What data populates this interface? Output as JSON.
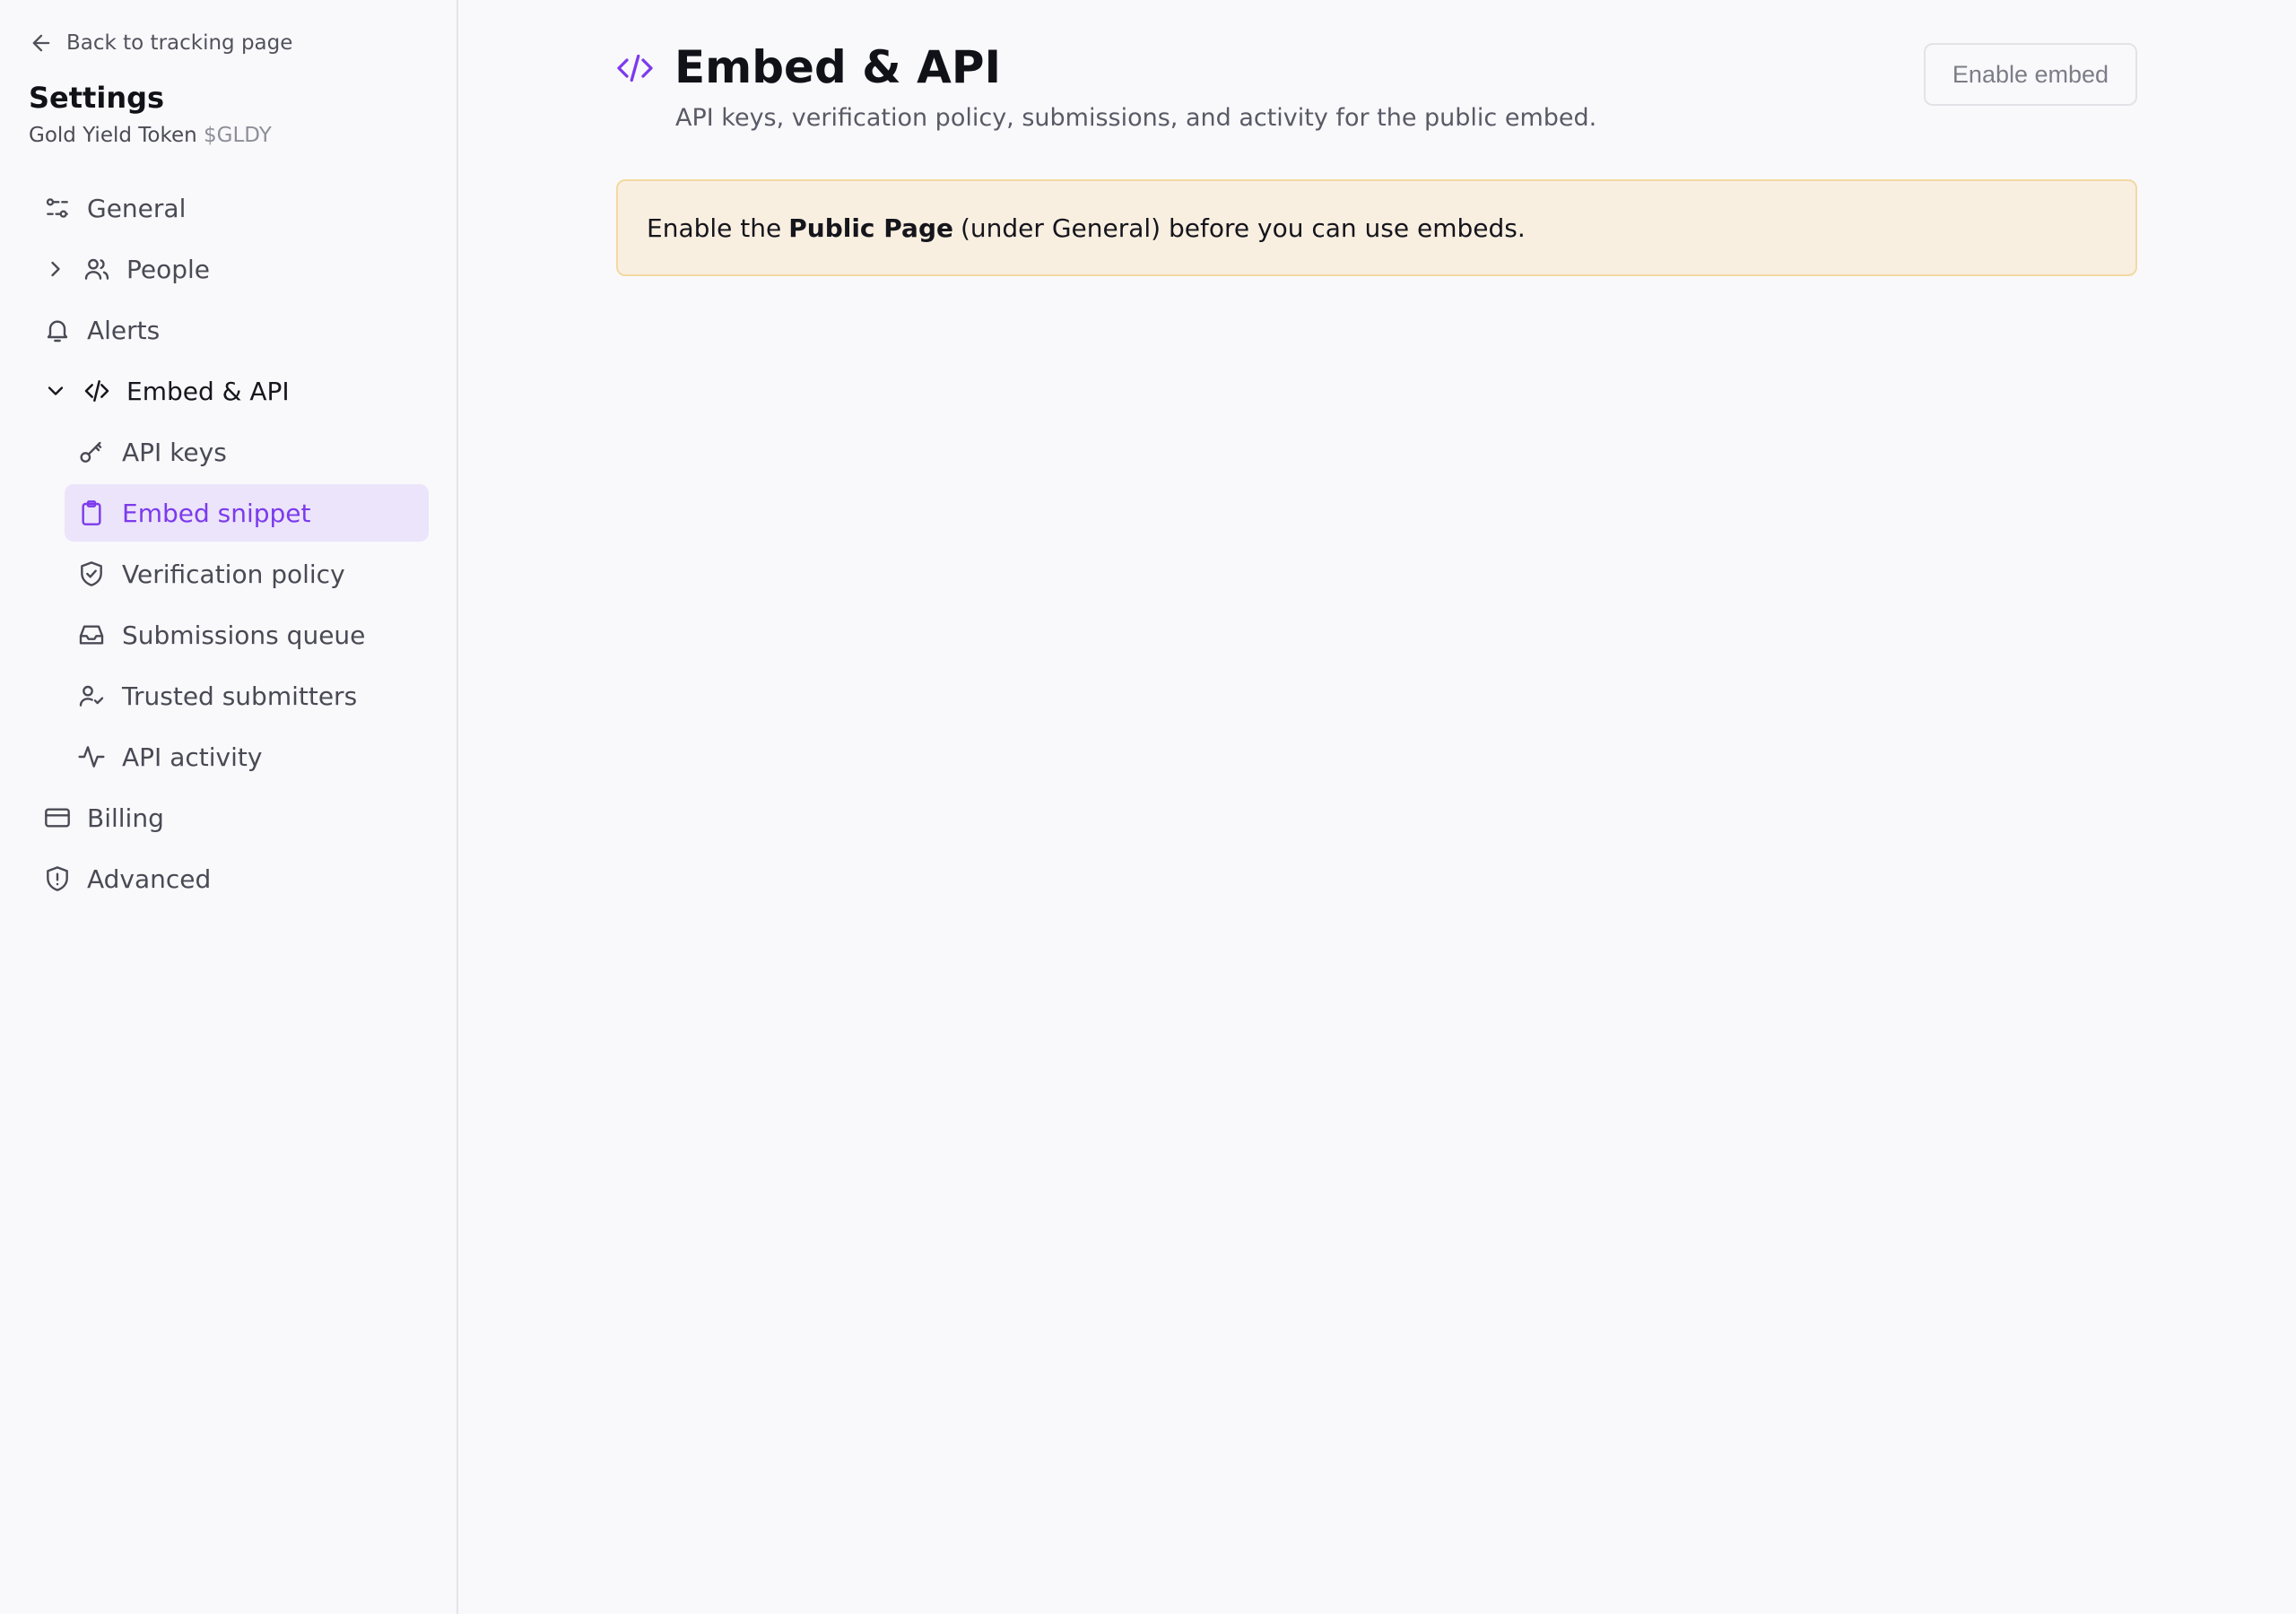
{
  "sidebar": {
    "back_link": "Back to tracking page",
    "title": "Settings",
    "project_name": "Gold Yield Token",
    "project_ticker": "$GLDY",
    "items": [
      {
        "label": "General",
        "icon": "sliders-icon"
      },
      {
        "label": "People",
        "icon": "users-icon",
        "expandable": true
      },
      {
        "label": "Alerts",
        "icon": "bell-icon"
      },
      {
        "label": "Embed & API",
        "icon": "code-icon",
        "expanded": true
      },
      {
        "label": "Billing",
        "icon": "credit-card-icon"
      },
      {
        "label": "Advanced",
        "icon": "shield-alert-icon"
      }
    ],
    "embed_sub_items": [
      {
        "label": "API keys",
        "icon": "key-icon"
      },
      {
        "label": "Embed snippet",
        "icon": "clipboard-icon",
        "active": true
      },
      {
        "label": "Verification policy",
        "icon": "shield-check-icon"
      },
      {
        "label": "Submissions queue",
        "icon": "inbox-icon"
      },
      {
        "label": "Trusted submitters",
        "icon": "user-check-icon"
      },
      {
        "label": "API activity",
        "icon": "activity-icon"
      }
    ]
  },
  "main": {
    "title": "Embed & API",
    "subtitle": "API keys, verification policy, submissions, and activity for the public embed.",
    "enable_button": "Enable embed",
    "notice": {
      "prefix": "Enable the",
      "emphasis": "Public Page",
      "suffix": "(under General) before you can use embeds."
    }
  },
  "colors": {
    "accent": "#7c3aed",
    "active_bg": "#ebe4fa",
    "notice_bg": "#f9efe1",
    "notice_border": "#f3d9a0"
  }
}
